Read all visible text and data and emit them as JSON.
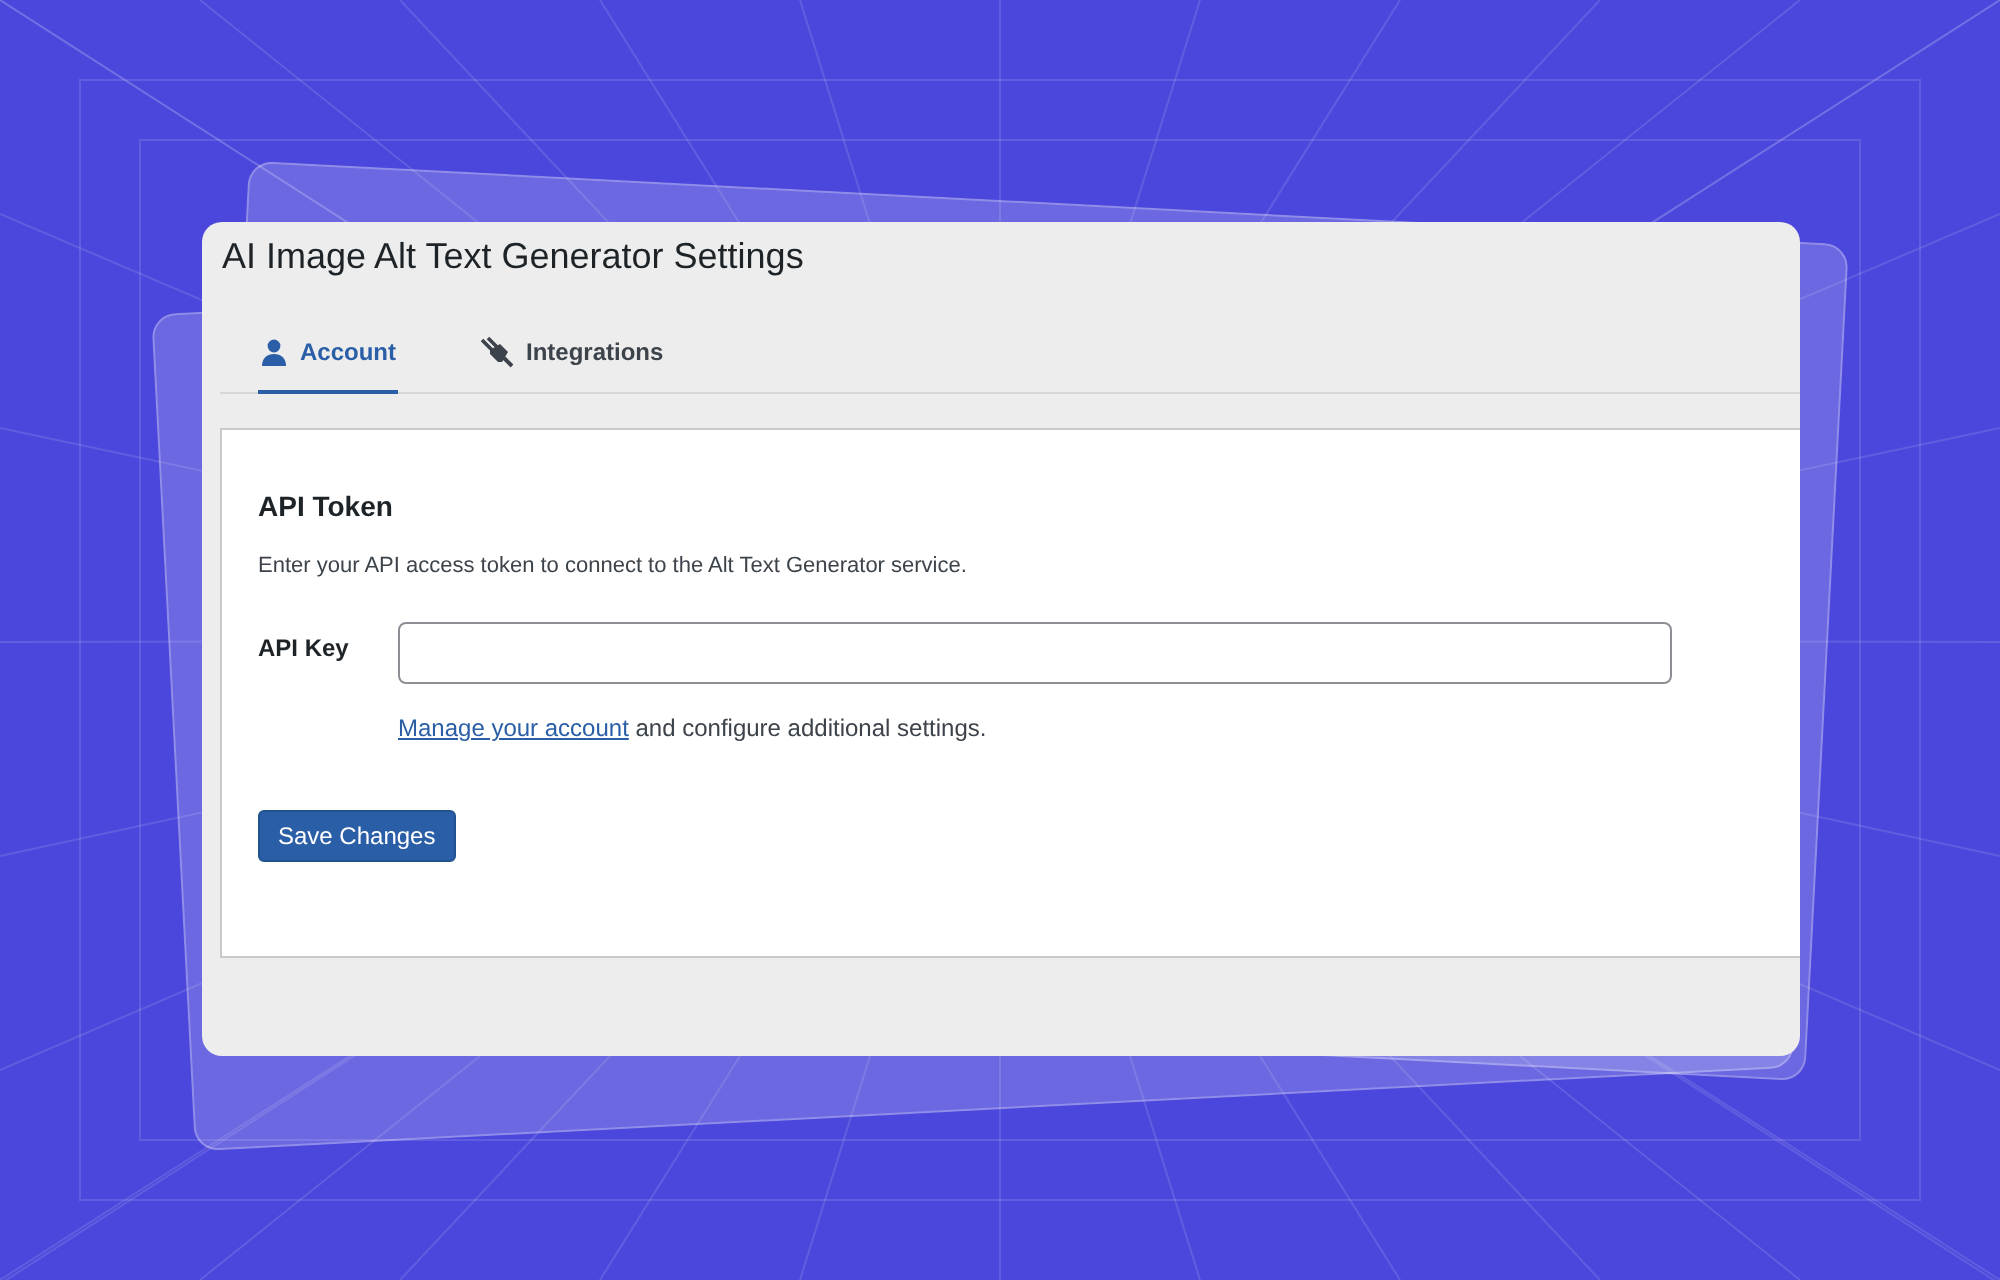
{
  "window": {
    "title": "AI Image Alt Text Generator Settings"
  },
  "tabs": [
    {
      "label": "Account",
      "kind": "user",
      "selected": true
    },
    {
      "label": "Integrations",
      "kind": "plug",
      "selected": false
    }
  ],
  "section": {
    "title": "API Token",
    "description": "Enter your API access token to connect to the Alt Text Generator service."
  },
  "api_key": {
    "label": "API Key"
  },
  "help": {
    "link": "Manage your account",
    "text": "and configure additional settings."
  },
  "buttons": [
    "Save Changes"
  ]
}
